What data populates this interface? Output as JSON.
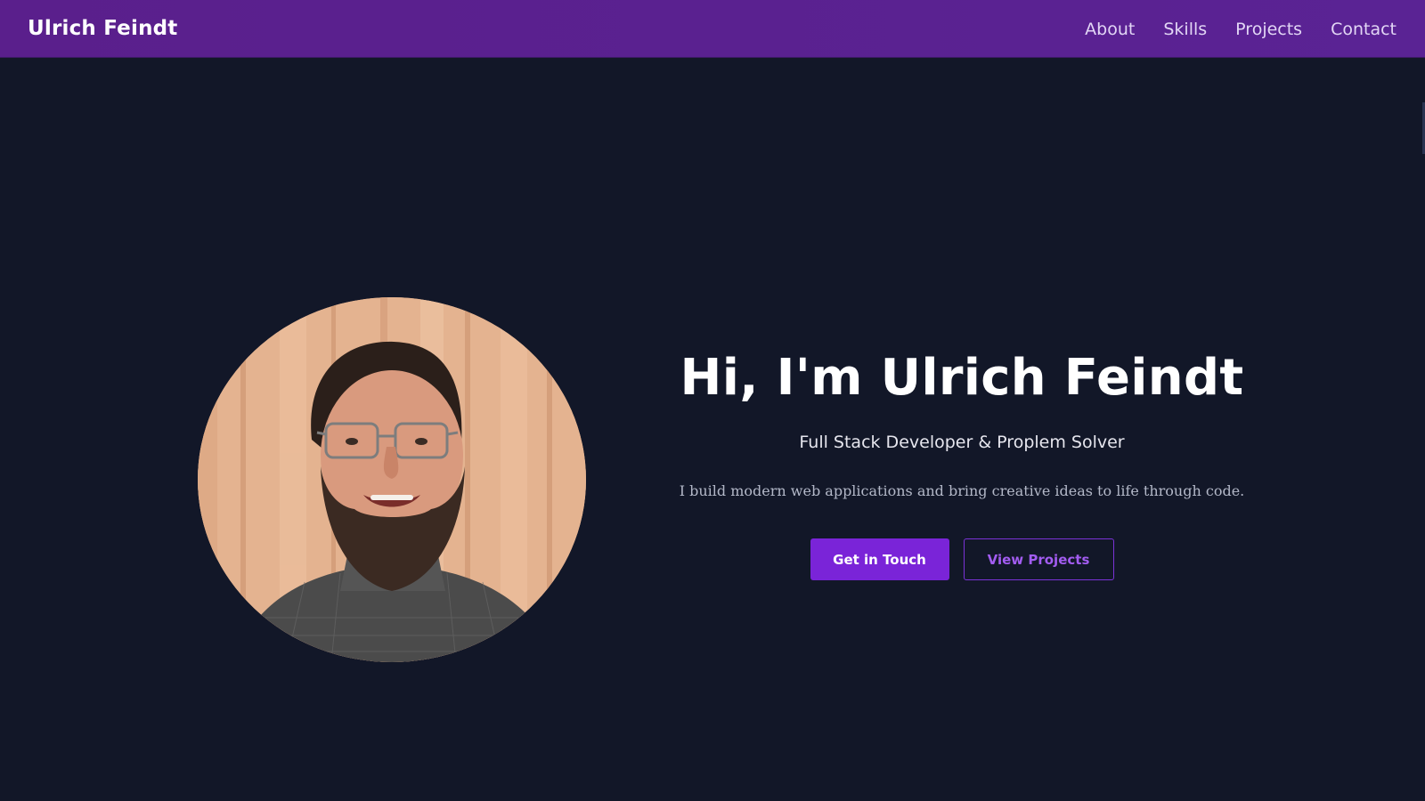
{
  "header": {
    "brand": "Ulrich Feindt",
    "nav": [
      {
        "label": "About"
      },
      {
        "label": "Skills"
      },
      {
        "label": "Projects"
      },
      {
        "label": "Contact"
      }
    ]
  },
  "hero": {
    "title": "Hi, I'm Ulrich Feindt",
    "subtitle": "Full Stack Developer & Proplem Solver",
    "description": "I build modern web applications and bring creative ideas to life through code.",
    "primary_button": "Get in Touch",
    "secondary_button": "View Projects",
    "avatar_alt": "Ulrich Feindt"
  },
  "colors": {
    "background": "#121728",
    "header": "#5a2394",
    "accent": "#7a24d8"
  }
}
